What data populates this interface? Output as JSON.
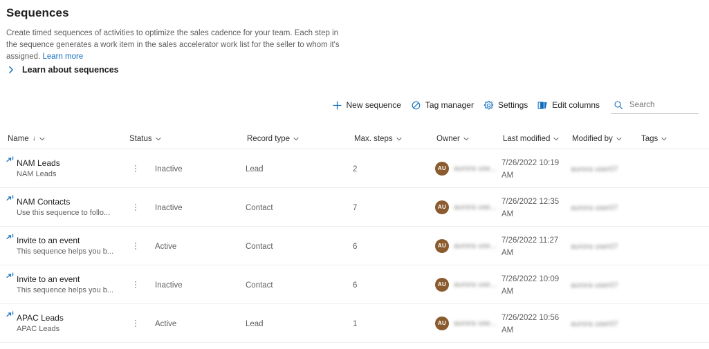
{
  "header": {
    "title": "Sequences",
    "description_part1": "Create timed sequences of activities to optimize the sales cadence for your team. Each step in the sequence generates a work item in the sales accelerator work list for the seller to whom it's assigned.",
    "learn_more_label": "Learn more",
    "expander_label": "Learn about sequences"
  },
  "toolbar": {
    "new_sequence_label": "New sequence",
    "tag_manager_label": "Tag manager",
    "settings_label": "Settings",
    "edit_columns_label": "Edit columns",
    "search_placeholder": "Search",
    "search_value": ""
  },
  "grid": {
    "columns": [
      {
        "key": "name",
        "label": "Name",
        "sorted": true,
        "sort_glyph": "↓"
      },
      {
        "key": "status",
        "label": "Status",
        "sorted": false,
        "sort_glyph": ""
      },
      {
        "key": "record",
        "label": "Record type",
        "sorted": false,
        "sort_glyph": ""
      },
      {
        "key": "steps",
        "label": "Max. steps",
        "sorted": false,
        "sort_glyph": ""
      },
      {
        "key": "owner",
        "label": "Owner",
        "sorted": false,
        "sort_glyph": ""
      },
      {
        "key": "mod",
        "label": "Last modified",
        "sorted": false,
        "sort_glyph": ""
      },
      {
        "key": "modby",
        "label": "Modified by",
        "sorted": false,
        "sort_glyph": ""
      },
      {
        "key": "tags",
        "label": "Tags",
        "sorted": false,
        "sort_glyph": ""
      }
    ],
    "rows": [
      {
        "name": "NAM Leads",
        "description": "NAM Leads",
        "status": "Inactive",
        "record_type": "Lead",
        "max_steps": "2",
        "owner_initials": "AU",
        "owner_name": "aurora use...",
        "last_modified": "7/26/2022 10:19 AM",
        "modified_by": "aurora user07",
        "tags": ""
      },
      {
        "name": "NAM Contacts",
        "description": "Use this sequence to follo...",
        "status": "Inactive",
        "record_type": "Contact",
        "max_steps": "7",
        "owner_initials": "AU",
        "owner_name": "aurora use...",
        "last_modified": "7/26/2022 12:35 AM",
        "modified_by": "aurora user07",
        "tags": ""
      },
      {
        "name": "Invite to an event",
        "description": "This sequence helps you b...",
        "status": "Active",
        "record_type": "Contact",
        "max_steps": "6",
        "owner_initials": "AU",
        "owner_name": "aurora use...",
        "last_modified": "7/26/2022 11:27 AM",
        "modified_by": "aurora user07",
        "tags": ""
      },
      {
        "name": "Invite to an event",
        "description": "This sequence helps you b...",
        "status": "Inactive",
        "record_type": "Contact",
        "max_steps": "6",
        "owner_initials": "AU",
        "owner_name": "aurora use...",
        "last_modified": "7/26/2022 10:09 AM",
        "modified_by": "aurora user07",
        "tags": ""
      },
      {
        "name": "APAC Leads",
        "description": "APAC Leads",
        "status": "Active",
        "record_type": "Lead",
        "max_steps": "1",
        "owner_initials": "AU",
        "owner_name": "aurora use...",
        "last_modified": "7/26/2022 10:56 AM",
        "modified_by": "aurora user07",
        "tags": ""
      }
    ]
  },
  "colors": {
    "accent": "#0f6cbd",
    "avatar": "#8a5b2e",
    "text_primary": "#201f1e",
    "text_secondary": "#605e5c",
    "divider": "#f0eeec"
  },
  "icons": {
    "new_sequence": "plus-icon",
    "tag_manager": "tag-icon",
    "settings": "gear-icon",
    "edit_columns": "columns-icon",
    "search": "search-icon",
    "expander": "chevron-right-icon",
    "column_menu": "chevron-down-icon",
    "row_item": "sequence-icon",
    "row_menu": "more-vertical-icon"
  }
}
